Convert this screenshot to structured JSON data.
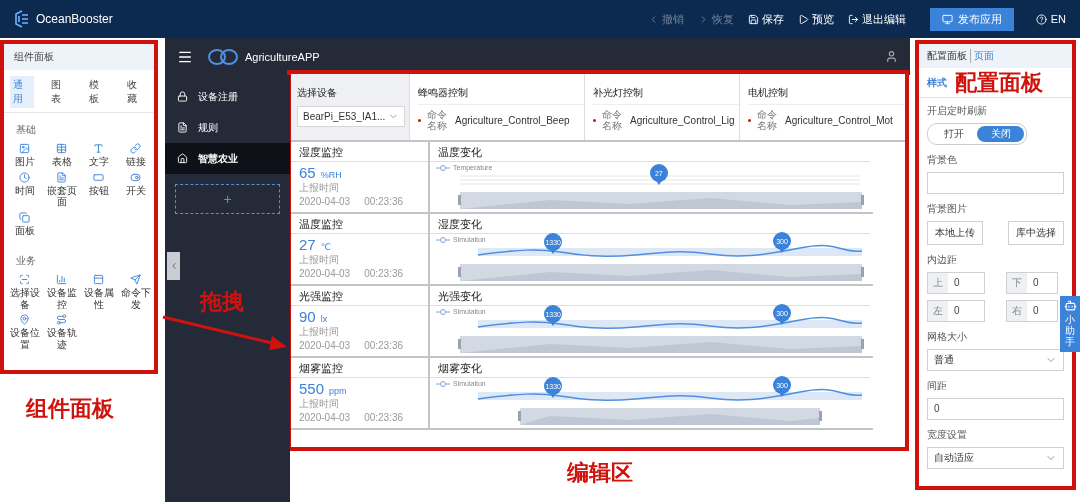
{
  "top_bar": {
    "logo": "OceanBooster",
    "actions": [
      {
        "label": "撤销",
        "disabled": true
      },
      {
        "label": "恢复",
        "disabled": true
      },
      {
        "label": "保存",
        "disabled": false
      },
      {
        "label": "预览",
        "disabled": false
      },
      {
        "label": "退出编辑",
        "disabled": false
      }
    ],
    "publish_button": "发布应用",
    "language": "EN"
  },
  "component_panel": {
    "title": "组件面板",
    "tabs": [
      {
        "label": "通用",
        "selected": true
      },
      {
        "label": "图表",
        "selected": false
      },
      {
        "label": "模板",
        "selected": false
      },
      {
        "label": "收藏",
        "selected": false
      }
    ],
    "sections": [
      {
        "title": "基础",
        "items": [
          {
            "label": "图片"
          },
          {
            "label": "表格"
          },
          {
            "label": "文字"
          },
          {
            "label": "链接"
          },
          {
            "label": "时间"
          },
          {
            "label": "嵌套页面"
          },
          {
            "label": "按钮"
          },
          {
            "label": "开关"
          },
          {
            "label": "面板"
          }
        ]
      },
      {
        "title": "业务",
        "items": [
          {
            "label": "选择设备"
          },
          {
            "label": "设备监控"
          },
          {
            "label": "设备属性"
          },
          {
            "label": "命令下发"
          },
          {
            "label": "设备位置"
          },
          {
            "label": "设备轨迹"
          }
        ]
      }
    ]
  },
  "app_header": {
    "title": "AgricultureAPP"
  },
  "sidebar": {
    "items": [
      {
        "label": "设备注册",
        "selected": false
      },
      {
        "label": "规则",
        "selected": false
      },
      {
        "label": "智慧农业",
        "selected": true
      }
    ],
    "add_button": "+"
  },
  "editor": {
    "device_select": {
      "label": "选择设备",
      "value": "BearPi_E53_IA1..."
    },
    "controls": [
      {
        "title": "蜂鸣器控制",
        "field_label": "命令名称",
        "value": "Agriculture_Control_Beep",
        "required": true
      },
      {
        "title": "补光灯控制",
        "field_label": "命令名称",
        "value": "Agriculture_Control_Lig",
        "required": true
      },
      {
        "title": "电机控制",
        "field_label": "命令名称",
        "value": "Agriculture_Control_Mot",
        "required": true
      }
    ],
    "monitors": [
      {
        "kind": "single-point",
        "title": "湿度监控",
        "value": "65",
        "unit": "%RH",
        "time_label": "上报时间",
        "date": "2020-04-03",
        "time": "00:23:36",
        "chart_title": "温度变化",
        "legend": "Temperature",
        "markers": [
          "27"
        ]
      },
      {
        "kind": "wave",
        "title": "温度监控",
        "value": "27",
        "unit": "℃",
        "time_label": "上报时间",
        "date": "2020-04-03",
        "time": "00:23:36",
        "chart_title": "湿度变化",
        "legend": "Simulation",
        "markers": [
          "1330",
          "300"
        ]
      },
      {
        "kind": "wave",
        "title": "光强监控",
        "value": "90",
        "unit": "lx",
        "time_label": "上报时间",
        "date": "2020-04-03",
        "time": "00:23:36",
        "chart_title": "光强变化",
        "legend": "Simulation",
        "markers": [
          "1330",
          "300"
        ]
      },
      {
        "kind": "wave",
        "title": "烟雾监控",
        "value": "550",
        "unit": "ppm",
        "time_label": "上报时间",
        "date": "2020-04-03",
        "time": "00:23:36",
        "chart_title": "烟雾变化",
        "legend": "Simulation",
        "markers": [
          "1330",
          "300"
        ]
      }
    ]
  },
  "config_panel": {
    "title": "配置面板",
    "link": "页面",
    "tabs": [
      {
        "label": "样式",
        "selected": true
      }
    ],
    "fields": [
      {
        "kind": "toggle",
        "label": "开启定时刷新",
        "options": [
          {
            "label": "打开",
            "selected": false
          },
          {
            "label": "关闭",
            "selected": true
          }
        ]
      },
      {
        "kind": "input",
        "label": "背景色"
      },
      {
        "kind": "buttons",
        "label": "背景图片",
        "buttons": [
          "本地上传",
          "库中选择"
        ]
      },
      {
        "kind": "padding",
        "label": "内边距",
        "sides": [
          {
            "label": "上",
            "value": "0"
          },
          {
            "label": "下",
            "value": "0"
          },
          {
            "label": "左",
            "value": "0"
          },
          {
            "label": "右",
            "value": "0"
          }
        ]
      },
      {
        "kind": "select",
        "label": "网格大小",
        "value": "普通"
      },
      {
        "kind": "input",
        "label": "间距",
        "value": "0"
      },
      {
        "kind": "select",
        "label": "宽度设置",
        "value": "自动适应"
      }
    ]
  },
  "helper_tab": "小助手",
  "annotations": {
    "component_panel": "组件面板",
    "drag": "拖拽",
    "editor": "编辑区",
    "config_panel": "配置面板"
  }
}
